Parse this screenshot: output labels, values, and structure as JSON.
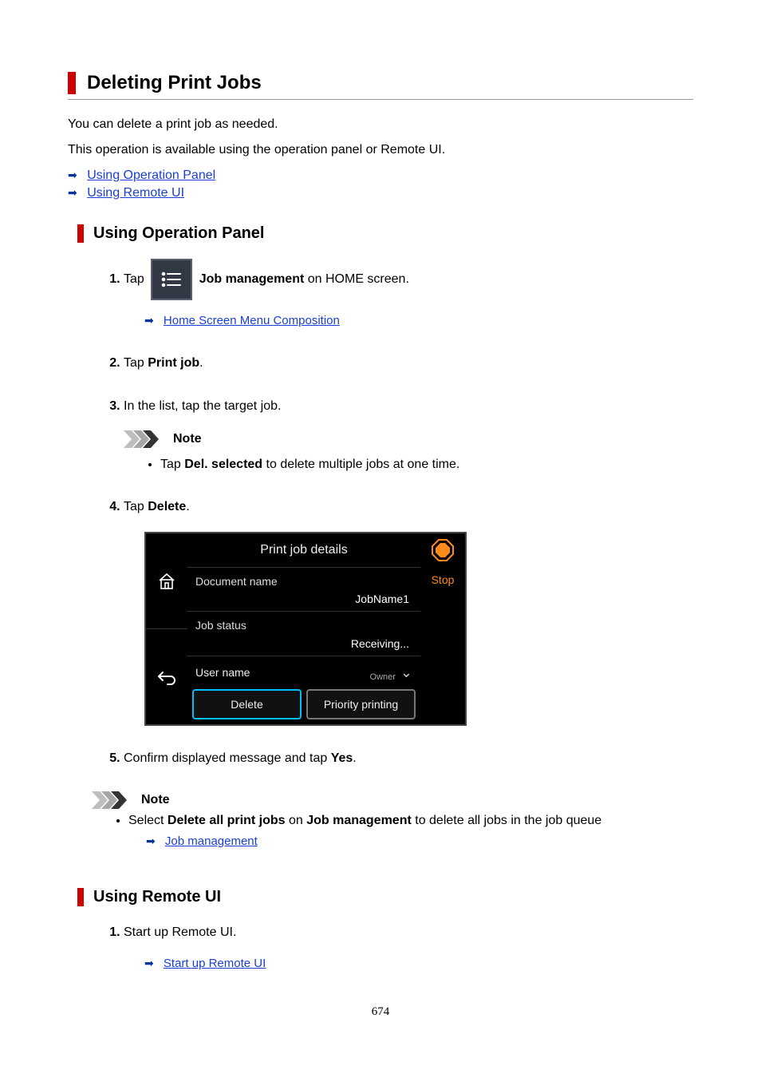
{
  "title": "Deleting Print Jobs",
  "intro1": "You can delete a print job as needed.",
  "intro2": "This operation is available using the operation panel or Remote UI.",
  "links": {
    "op_panel": "Using Operation Panel",
    "remote_ui": "Using Remote UI"
  },
  "section1": {
    "heading": "Using Operation Panel",
    "step1_prefix": "Tap ",
    "step1_bold": "Job management",
    "step1_suffix": " on HOME screen.",
    "step1_sublink": "Home Screen Menu Composition",
    "step2_prefix": "Tap ",
    "step2_bold": "Print job",
    "step2_suffix": ".",
    "step3": "In the list, tap the target job.",
    "note_label": "Note",
    "note3_prefix": "Tap ",
    "note3_bold": "Del. selected",
    "note3_suffix": " to delete multiple jobs at one time.",
    "step4_prefix": "Tap ",
    "step4_bold": "Delete",
    "step4_suffix": ".",
    "step5_prefix": "Confirm displayed message and tap ",
    "step5_bold": "Yes",
    "step5_suffix": "."
  },
  "panel": {
    "title": "Print job details",
    "doc_label": "Document name",
    "doc_value": "JobName1",
    "status_label": "Job status",
    "status_value": "Receiving...",
    "user_label": "User name",
    "owner": "Owner",
    "btn_delete": "Delete",
    "btn_priority": "Priority printing",
    "stop": "Stop"
  },
  "bottom_note": {
    "label": "Note",
    "text_prefix": "Select ",
    "bold1": "Delete all print jobs",
    "mid": " on ",
    "bold2": "Job management",
    "text_suffix": " to delete all jobs in the job queue",
    "sublink": "Job management"
  },
  "section2": {
    "heading": "Using Remote UI",
    "step1": "Start up Remote UI.",
    "step1_sublink": "Start up Remote UI"
  },
  "pagenum": "674"
}
